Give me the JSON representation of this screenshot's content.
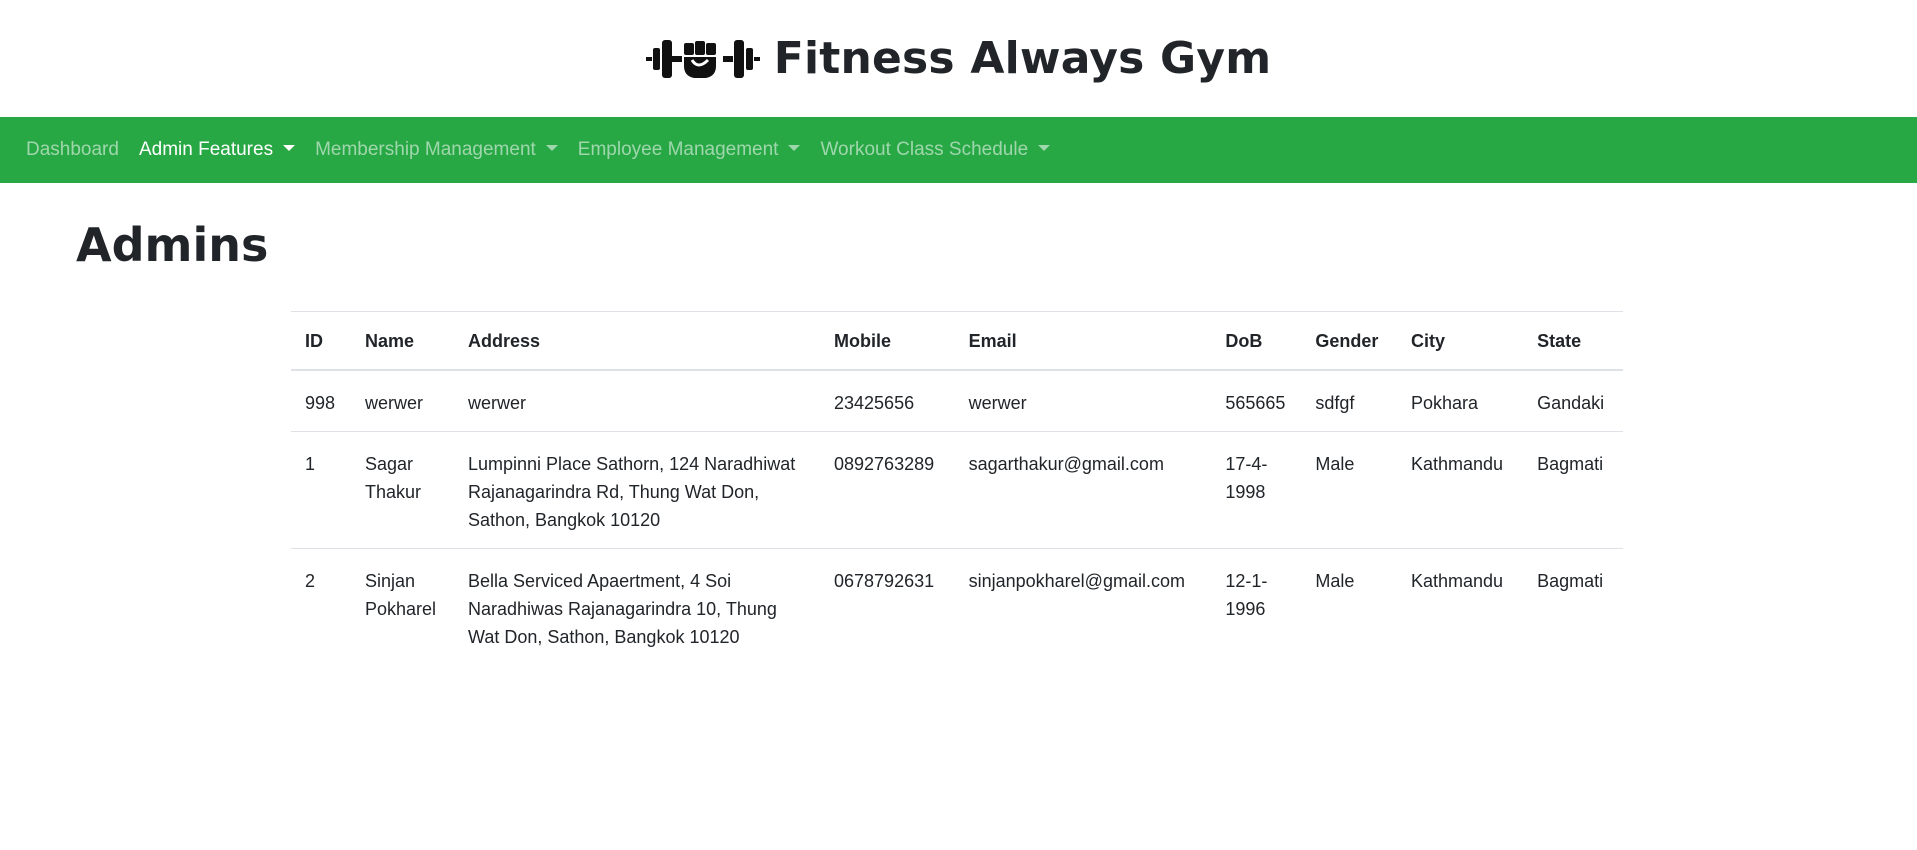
{
  "header": {
    "logo_icon": "dumbbell-fist-icon",
    "title": "Fitness Always Gym"
  },
  "navbar": {
    "accent_color": "#28a745",
    "items": [
      {
        "label": "Dashboard",
        "dropdown": false,
        "active": false
      },
      {
        "label": "Admin Features",
        "dropdown": true,
        "active": true
      },
      {
        "label": "Membership Management",
        "dropdown": true,
        "active": false
      },
      {
        "label": "Employee Management",
        "dropdown": true,
        "active": false
      },
      {
        "label": "Workout Class Schedule",
        "dropdown": true,
        "active": false
      }
    ]
  },
  "page": {
    "title": "Admins"
  },
  "table": {
    "headers": [
      "ID",
      "Name",
      "Address",
      "Mobile",
      "Email",
      "DoB",
      "Gender",
      "City",
      "State"
    ],
    "rows": [
      [
        "998",
        "werwer",
        "werwer",
        "23425656",
        "werwer",
        "565665",
        "sdfgf",
        "Pokhara",
        "Gandaki"
      ],
      [
        "1",
        "Sagar Thakur",
        "Lumpinni Place Sathorn, 124 Naradhiwat Rajanagarindra Rd, Thung Wat Don, Sathon, Bangkok 10120",
        "0892763289",
        "sagarthakur@gmail.com",
        "17-4-1998",
        "Male",
        "Kathmandu",
        "Bagmati"
      ],
      [
        "2",
        "Sinjan Pokharel",
        "Bella Serviced Apaertment, 4 Soi Naradhiwas Rajanagarindra 10, Thung Wat Don, Sathon, Bangkok 10120",
        "0678792631",
        "sinjanpokharel@gmail.com",
        "12-1-1996",
        "Male",
        "Kathmandu",
        "Bagmati"
      ]
    ]
  }
}
